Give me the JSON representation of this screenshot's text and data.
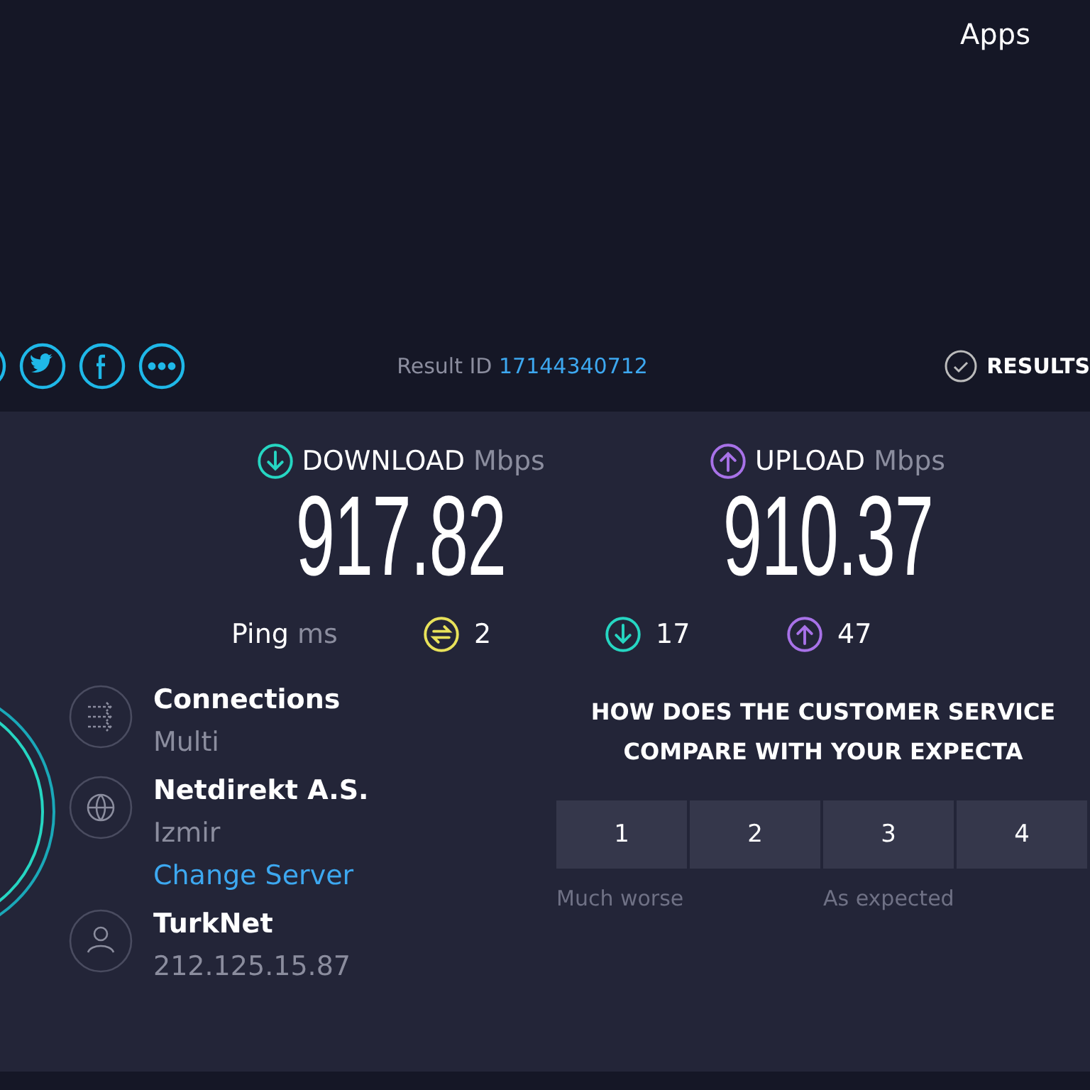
{
  "header": {
    "apps_link": "Apps",
    "result_label": "Result ID",
    "result_id": "17144340712",
    "results_link": "RESULTS"
  },
  "speeds": [
    {
      "kind": "download",
      "label": "DOWNLOAD",
      "unit": "Mbps",
      "value": "917.82"
    },
    {
      "kind": "upload",
      "label": "UPLOAD",
      "unit": "Mbps",
      "value": "910.37"
    }
  ],
  "ping": {
    "label": "Ping",
    "unit": "ms",
    "readings": [
      {
        "kind": "idle",
        "value": "2"
      },
      {
        "kind": "download",
        "value": "17"
      },
      {
        "kind": "upload",
        "value": "47"
      }
    ]
  },
  "info": [
    {
      "kind": "connections",
      "title": "Connections",
      "detail": "Multi"
    },
    {
      "kind": "server",
      "title": "Netdirekt A.S.",
      "detail": "Izmir",
      "link": "Change Server"
    },
    {
      "kind": "provider",
      "title": "TurkNet",
      "detail": "212.125.15.87"
    }
  ],
  "survey": {
    "question_lines": [
      "HOW DOES THE CUSTOMER SERVICE",
      "COMPARE WITH YOUR EXPECTA"
    ],
    "options": [
      "1",
      "2",
      "3",
      "4"
    ],
    "scale_labels": [
      "Much worse",
      "As expected"
    ]
  }
}
